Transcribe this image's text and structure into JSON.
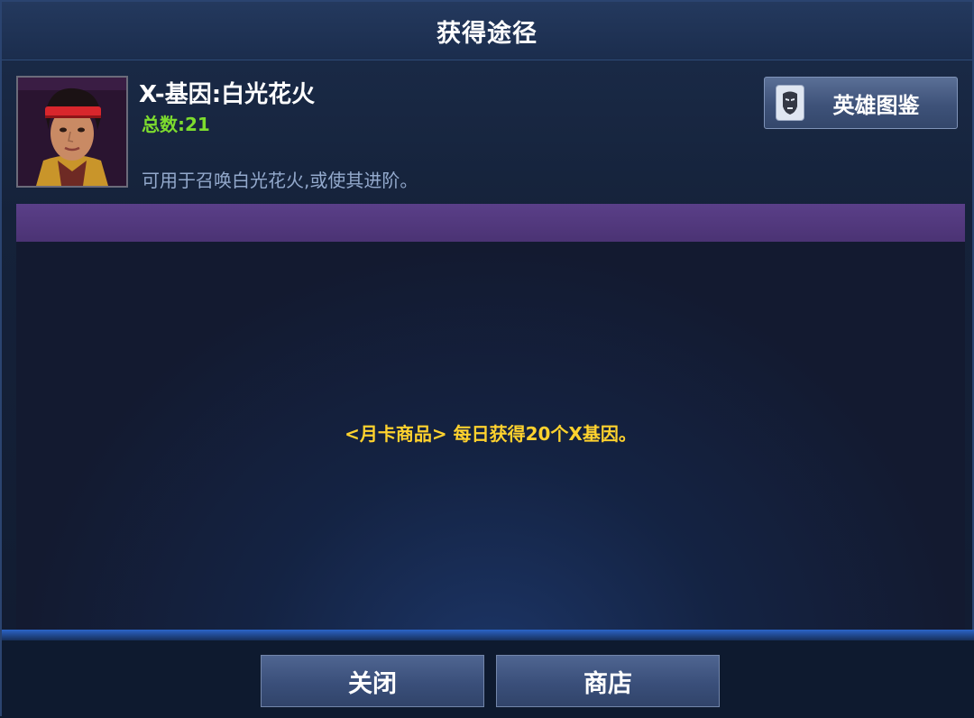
{
  "dialog": {
    "title": "获得途径"
  },
  "item": {
    "name": "X-基因:白光花火",
    "count": "总数:21",
    "description": "可用于召唤白光花火,或使其进阶。"
  },
  "codex_button": {
    "label": "英雄图鉴",
    "icon": "iron-man-helmet-icon"
  },
  "sources": [
    {
      "text": "<月卡商品> 每日获得20个X基因。"
    }
  ],
  "footer": {
    "close_label": "关闭",
    "shop_label": "商店"
  },
  "colors": {
    "count": "#7ddc2e",
    "source_text": "#ffd22e",
    "banner": "#4b3374"
  }
}
